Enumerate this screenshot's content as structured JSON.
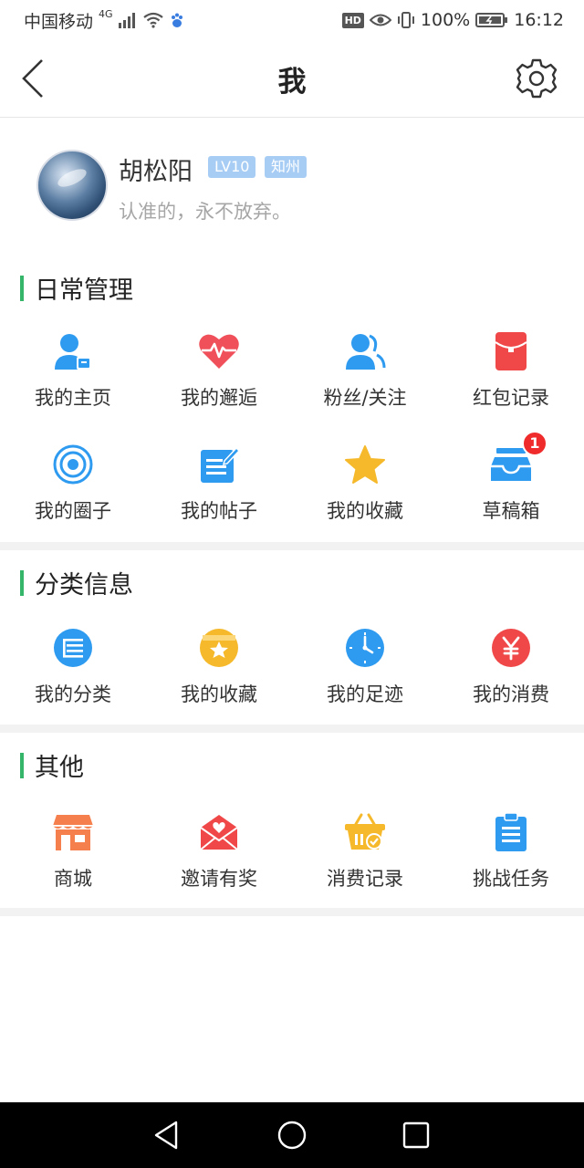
{
  "status_bar": {
    "carrier": "中国移动",
    "network": "4G",
    "battery": "100%",
    "time": "16:12",
    "hd_label": "HD"
  },
  "nav": {
    "title": "我"
  },
  "profile": {
    "name": "胡松阳",
    "level": "LV10",
    "rank": "知州",
    "signature": "认准的，永不放弃。"
  },
  "sections": {
    "daily": {
      "title": "日常管理",
      "items": [
        {
          "label": "我的主页",
          "icon": "user-home-icon",
          "color": "#2e9bf0"
        },
        {
          "label": "我的邂逅",
          "icon": "heart-pulse-icon",
          "color": "#f0505a"
        },
        {
          "label": "粉丝/关注",
          "icon": "fans-icon",
          "color": "#2e9bf0"
        },
        {
          "label": "红包记录",
          "icon": "red-envelope-icon",
          "color": "#f04848"
        },
        {
          "label": "我的圈子",
          "icon": "circle-target-icon",
          "color": "#2e9bf0"
        },
        {
          "label": "我的帖子",
          "icon": "post-edit-icon",
          "color": "#2e9bf0"
        },
        {
          "label": "我的收藏",
          "icon": "star-icon",
          "color": "#f5b92b"
        },
        {
          "label": "草稿箱",
          "icon": "draft-box-icon",
          "color": "#2e9bf0",
          "badge": "1"
        }
      ]
    },
    "category": {
      "title": "分类信息",
      "items": [
        {
          "label": "我的分类",
          "icon": "category-list-icon",
          "color": "#2e9bf0"
        },
        {
          "label": "我的收藏",
          "icon": "favorite-box-icon",
          "color": "#f5b92b"
        },
        {
          "label": "我的足迹",
          "icon": "clock-icon",
          "color": "#2e9bf0"
        },
        {
          "label": "我的消费",
          "icon": "yuan-icon",
          "color": "#f04848"
        }
      ]
    },
    "other": {
      "title": "其他",
      "items": [
        {
          "label": "商城",
          "icon": "shop-icon",
          "color": "#f5804e"
        },
        {
          "label": "邀请有奖",
          "icon": "invite-envelope-icon",
          "color": "#f04848"
        },
        {
          "label": "消费记录",
          "icon": "basket-check-icon",
          "color": "#f5b92b"
        },
        {
          "label": "挑战任务",
          "icon": "clipboard-task-icon",
          "color": "#2e9bf0"
        }
      ]
    }
  }
}
